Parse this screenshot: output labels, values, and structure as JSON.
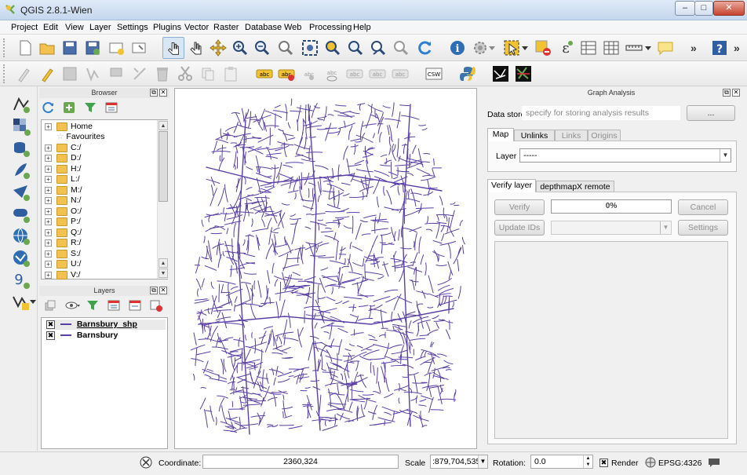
{
  "window": {
    "title": "QGIS 2.8.1-Wien",
    "minimize": "–",
    "maximize": "□",
    "close": "✕"
  },
  "menu": [
    "Project",
    "Edit",
    "View",
    "Layer",
    "Settings",
    "Plugins",
    "Vector",
    "Raster",
    "Database",
    "Web",
    "Processing",
    "Help"
  ],
  "browser": {
    "title": "Browser",
    "items": [
      "Home",
      "Favourites",
      "C:/",
      "D:/",
      "H:/",
      "L:/",
      "M:/",
      "N:/",
      "O:/",
      "P:/",
      "Q:/",
      "R:/",
      "S:/",
      "U:/",
      "V:/"
    ]
  },
  "layers": {
    "title": "Layers",
    "items": [
      {
        "name": "Barnsbury_shp",
        "checked": "✖"
      },
      {
        "name": "Barnsbury",
        "checked": "✖"
      }
    ]
  },
  "graph_analysis": {
    "title": "Graph Analysis",
    "data_store_label": "Data store",
    "data_store_placeholder": "specify for storing analysis results",
    "browse_label": "...",
    "tabs": [
      "Map",
      "Unlinks",
      "Links",
      "Origins"
    ],
    "layer_label": "Layer",
    "layer_value": "-----",
    "lower_tabs": [
      "Verify layer",
      "depthmapX remote"
    ],
    "verify_label": "Verify",
    "progress_text": "0%",
    "progress_value": 0.0,
    "cancel_label": "Cancel",
    "update_ids_label": "Update IDs",
    "settings_label": "Settings"
  },
  "status": {
    "coordinate_label": "Coordinate:",
    "coordinate_value": "2360,324",
    "scale_label": "Scale",
    "scale_value": ":879,704,535",
    "rotation_label": "Rotation:",
    "rotation_value": "0.0",
    "render_label": "Render",
    "render_checked": "✖",
    "crs_label": "EPSG:4326"
  },
  "colors": {
    "network": "#5a3fa6",
    "accent": "#3b8ad9"
  }
}
